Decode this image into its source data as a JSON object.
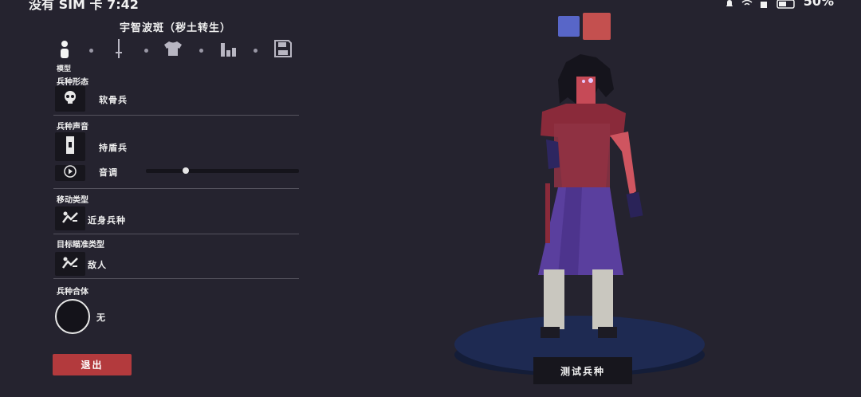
{
  "status_bar": {
    "carrier_time": "没有 SIM 卡 7:42",
    "battery": "50%"
  },
  "unit": {
    "title": "宇智波斑（秽土转生）"
  },
  "tabs": {
    "items": [
      {
        "name": "model",
        "icon": "person-icon"
      },
      {
        "name": "weapon",
        "icon": "sword-icon"
      },
      {
        "name": "clothing",
        "icon": "shirt-icon"
      },
      {
        "name": "stats",
        "icon": "bars-icon"
      },
      {
        "name": "save",
        "icon": "floppy-icon"
      }
    ],
    "active_label": "模型"
  },
  "sections": {
    "form": {
      "label": "兵种形态",
      "value": "软骨兵",
      "icon": "skull-icon"
    },
    "voice": {
      "label": "兵种声音",
      "value": "持盾兵",
      "icon": "shield-icon"
    },
    "pitch": {
      "label": "音调",
      "icon": "play-icon",
      "level": 0.26
    },
    "movement": {
      "label": "移动类型",
      "value": "近身兵种",
      "icon": "melee-unit-icon"
    },
    "targeting": {
      "label": "目标瞄准类型",
      "value": "敌人",
      "icon": "target-unit-icon"
    },
    "combine": {
      "label": "兵种合体",
      "value": "无"
    }
  },
  "buttons": {
    "exit": "退出",
    "test": "测试兵种"
  },
  "colors": {
    "team_blue": "#5866c8",
    "team_red": "#c4504f",
    "exit_red": "#b33a3d",
    "background": "#25232f"
  }
}
